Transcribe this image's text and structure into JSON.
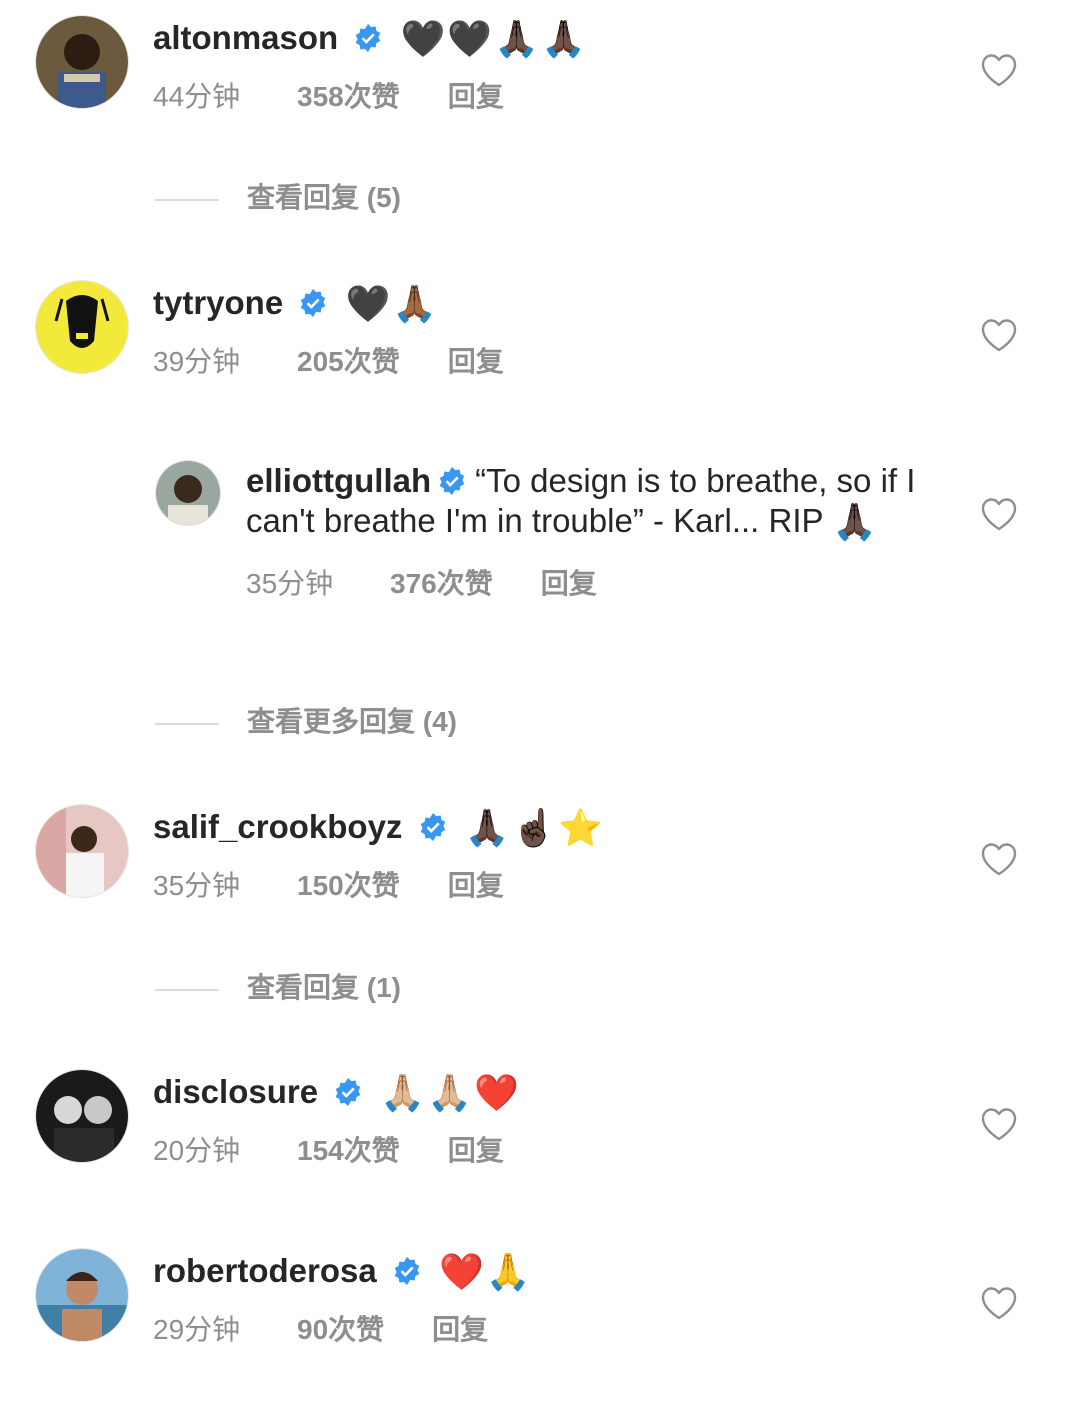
{
  "comments": [
    {
      "username": "altonmason",
      "emojis": "🖤🖤🙏🏿🙏🏿",
      "time": "44分钟",
      "likes": "358次赞",
      "reply": "回复"
    },
    {
      "username": "tytryone",
      "emojis": "🖤🙏🏾",
      "time": "39分钟",
      "likes": "205次赞",
      "reply": "回复"
    },
    {
      "username": "elliottgullah",
      "text": "“To design is to breathe, so if I can't breathe I'm in trouble” - Karl... RIP",
      "emojis": "🙏🏿",
      "time": "35分钟",
      "likes": "376次赞",
      "reply": "回复"
    },
    {
      "username": "salif_crookboyz",
      "emojis": "🙏🏿☝🏿⭐",
      "time": "35分钟",
      "likes": "150次赞",
      "reply": "回复"
    },
    {
      "username": "disclosure",
      "emojis": "🙏🏼🙏🏼❤️",
      "time": "20分钟",
      "likes": "154次赞",
      "reply": "回复"
    },
    {
      "username": "robertoderosa",
      "emojis": "❤️🙏",
      "time": "29分钟",
      "likes": "90次赞",
      "reply": "回复"
    }
  ],
  "view_replies": [
    "查看回复 (5)",
    "查看更多回复 (4)",
    "查看回复 (1)"
  ],
  "icons": {
    "verified": "verified-badge-icon",
    "like": "heart-outline-icon"
  },
  "colors": {
    "verified_blue": "#3897f0",
    "meta_gray": "#8e8e8e",
    "text": "#262626"
  }
}
